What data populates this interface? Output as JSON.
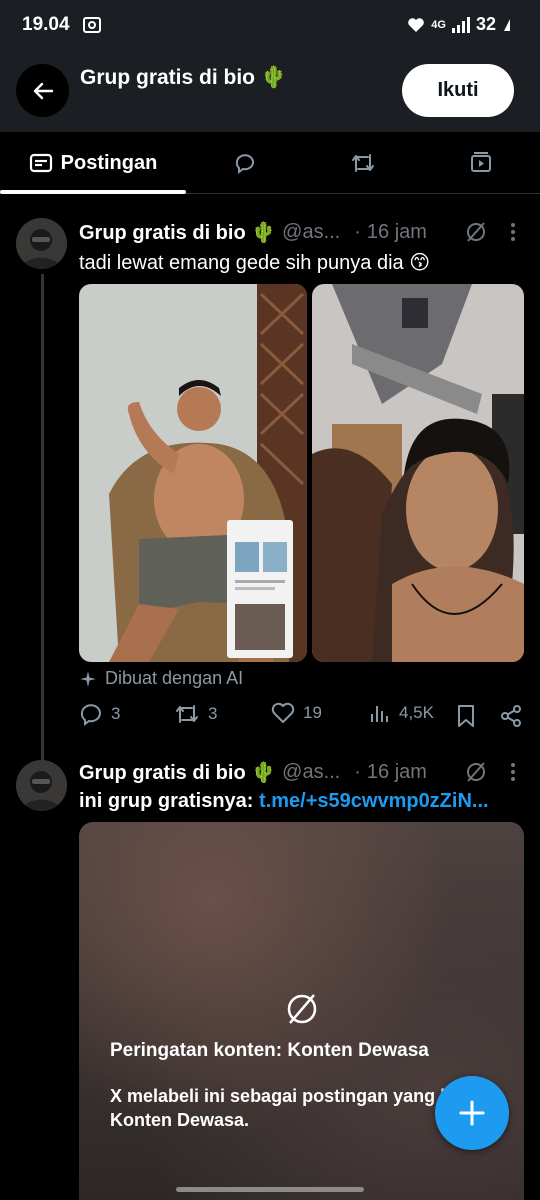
{
  "status": {
    "time": "19.04",
    "network": "4G",
    "battery": "32"
  },
  "header": {
    "title": "Grup gratis di bio 🌵",
    "follow_label": "Ikuti"
  },
  "tabs": [
    {
      "label": "Postingan",
      "icon": "posts-icon",
      "active": true
    },
    {
      "label": "",
      "icon": "reply-icon"
    },
    {
      "label": "",
      "icon": "repost-icon"
    },
    {
      "label": "",
      "icon": "media-icon"
    }
  ],
  "posts": [
    {
      "author": "Grup gratis di bio 🌵",
      "handle": "@as...",
      "time": "16 jam",
      "text": "tadi lewat emang gede sih punya dia 😙",
      "ai_label": "Dibuat dengan AI",
      "replies": "3",
      "reposts": "3",
      "likes": "19",
      "views": "4,5K"
    },
    {
      "author": "Grup gratis di bio 🌵",
      "handle": "@as...",
      "time": "16 jam",
      "text_prefix": "ini grup gratisnya: ",
      "link": "t.me/+s59cwvmp0zZiN...",
      "warning_title": "Peringatan konten: Konten Dewasa",
      "warning_body": "X melabeli ini sebagai postingan yang berisi Konten Dewasa."
    }
  ],
  "colors": {
    "accent": "#1d9bf0",
    "muted": "#71767b",
    "background": "#000000",
    "header_bg": "#1b1f23"
  }
}
